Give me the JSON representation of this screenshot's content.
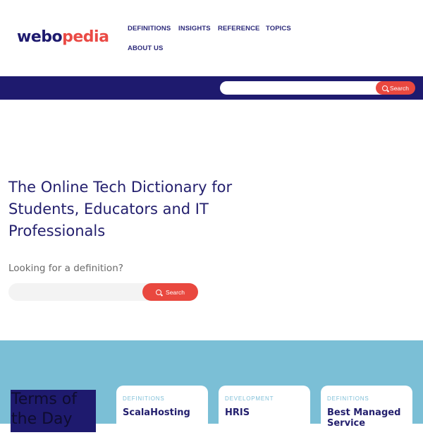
{
  "brand": {
    "logo_part1": "webo",
    "logo_part2": "pedia",
    "color_navy": "#1e1a6e",
    "color_red": "#e9483f"
  },
  "nav": {
    "items": [
      {
        "label": "DEFINITIONS"
      },
      {
        "label": "INSIGHTS"
      },
      {
        "label": "REFERENCE"
      },
      {
        "label": "TOPICS"
      },
      {
        "label": "ABOUT US"
      }
    ]
  },
  "top_search": {
    "placeholder": "",
    "value": "",
    "button_label": "Search",
    "icon": "search-icon"
  },
  "hero": {
    "title": "The Online Tech Dictionary for Students, Educators and IT Professionals",
    "subtitle": "Looking for a definition?",
    "search": {
      "placeholder": "",
      "value": "",
      "button_label": "Search",
      "icon": "search-icon"
    }
  },
  "terms_of_day": {
    "heading": "Terms of the Day",
    "background": "#7bbfd6",
    "cards": [
      {
        "category": "DEFINITIONS",
        "title": "ScalaHosting"
      },
      {
        "category": "DEVELOPMENT",
        "title": "HRIS"
      },
      {
        "category": "DEFINITIONS",
        "title": "Best Managed Service"
      }
    ]
  }
}
